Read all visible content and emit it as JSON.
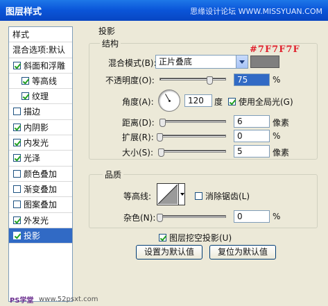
{
  "title_bar": {
    "title": "图层样式",
    "site": "思缘设计论坛 WWW.MISSYUAN.COM"
  },
  "left_panel": {
    "items": [
      {
        "label": "样式",
        "checked": null
      },
      {
        "label": "混合选项:默认",
        "checked": null
      },
      {
        "label": "斜面和浮雕",
        "checked": true
      },
      {
        "label": "等高线",
        "checked": true
      },
      {
        "label": "纹理",
        "checked": true
      },
      {
        "label": "描边",
        "checked": false
      },
      {
        "label": "内阴影",
        "checked": true
      },
      {
        "label": "内发光",
        "checked": true
      },
      {
        "label": "光泽",
        "checked": true
      },
      {
        "label": "颜色叠加",
        "checked": false
      },
      {
        "label": "渐变叠加",
        "checked": false
      },
      {
        "label": "图案叠加",
        "checked": false
      },
      {
        "label": "外发光",
        "checked": true
      },
      {
        "label": "投影",
        "checked": true
      }
    ]
  },
  "drop_shadow": {
    "section_title": "投影",
    "structure": {
      "group_label": "结构",
      "blend_mode_label": "混合模式(B):",
      "blend_mode_value": "正片叠底",
      "color_code": "#7F7F7F",
      "swatch_color": "#7f7f7f",
      "opacity_label": "不透明度(O):",
      "opacity_value": "75",
      "opacity_unit": "%",
      "opacity_level": 0.75,
      "angle_label": "角度(A):",
      "angle_value": "120",
      "angle_unit": "度",
      "global_light_label": "使用全局光(G)",
      "global_light_checked": true,
      "distance_label": "距离(D):",
      "distance_value": "6",
      "distance_unit": "像素",
      "spread_label": "扩展(R):",
      "spread_value": "0",
      "spread_unit": "%",
      "size_label": "大小(S):",
      "size_value": "5",
      "size_unit": "像素"
    },
    "quality": {
      "group_label": "品质",
      "contour_label": "等高线:",
      "anti_alias_label": "消除锯齿(L)",
      "anti_alias_checked": false,
      "noise_label": "杂色(N):",
      "noise_value": "0",
      "noise_unit": "%"
    },
    "knockout_label": "图层挖空投影(U)",
    "knockout_checked": true,
    "buttons": {
      "make_default": "设置为默认值",
      "reset_default": "复位为默认值"
    }
  },
  "watermark": {
    "left": "PS学堂",
    "right": "www.52psxt.com"
  }
}
